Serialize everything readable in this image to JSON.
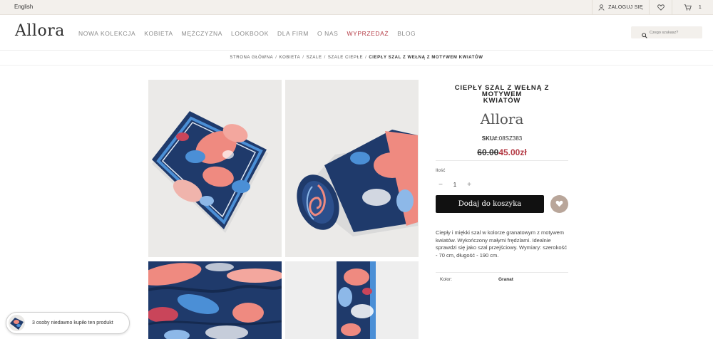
{
  "topbar": {
    "language": "English",
    "login_label": "ZALOGUJ SIĘ",
    "cart_count": "1"
  },
  "header": {
    "logo": "Allora",
    "nav": [
      {
        "label": "NOWA KOLEKCJA"
      },
      {
        "label": "KOBIETA"
      },
      {
        "label": "MĘŻCZYZNA"
      },
      {
        "label": "LOOKBOOK"
      },
      {
        "label": "DLA FIRM"
      },
      {
        "label": "O NAS"
      },
      {
        "label": "WYPRZEDAŻ"
      },
      {
        "label": "BLOG"
      }
    ],
    "search_placeholder": "Czego szukasz?"
  },
  "breadcrumb": {
    "items": [
      "STRONA GŁÓWNA",
      "KOBIETA",
      "SZALE",
      "SZALE CIEPŁE"
    ],
    "current": "CIEPŁY SZAL Z WEŁNĄ Z MOTYWEM KWIATÓW"
  },
  "product": {
    "title_line1": "CIEPŁY SZAL Z WEŁNĄ Z MOTYWEM",
    "title_line2": "KWIATÓW",
    "brand": "Allora",
    "sku_label": "SKU#:",
    "sku": "08SZ383",
    "price_old": "60.00",
    "price_new": "45.00zł",
    "qty_label": "Ilość",
    "qty": "1",
    "add_to_cart": "Dodaj do koszyka",
    "description": "Ciepły i miękki szal w kolorze granatowym z motywem kwiatów. Wykończony małymi frędzlami. Idealnie sprawdzi się jako szal przejściowy. Wymiary: szerokość - 70 cm, długość - 190 cm.",
    "attributes": [
      {
        "key": "Kolor:",
        "value": "Granat"
      }
    ]
  },
  "popup": {
    "text": "3 osoby niedawno kupiło ten produkt"
  },
  "colors": {
    "accent_sale": "#b43a44",
    "topbar_bg": "#f3f0ec",
    "button_bg": "#111111",
    "wishlist_bg": "#b9a69a",
    "scarf_navy": "#1f3a6b",
    "scarf_coral": "#ef8a80",
    "scarf_blue": "#4b8fd6"
  }
}
